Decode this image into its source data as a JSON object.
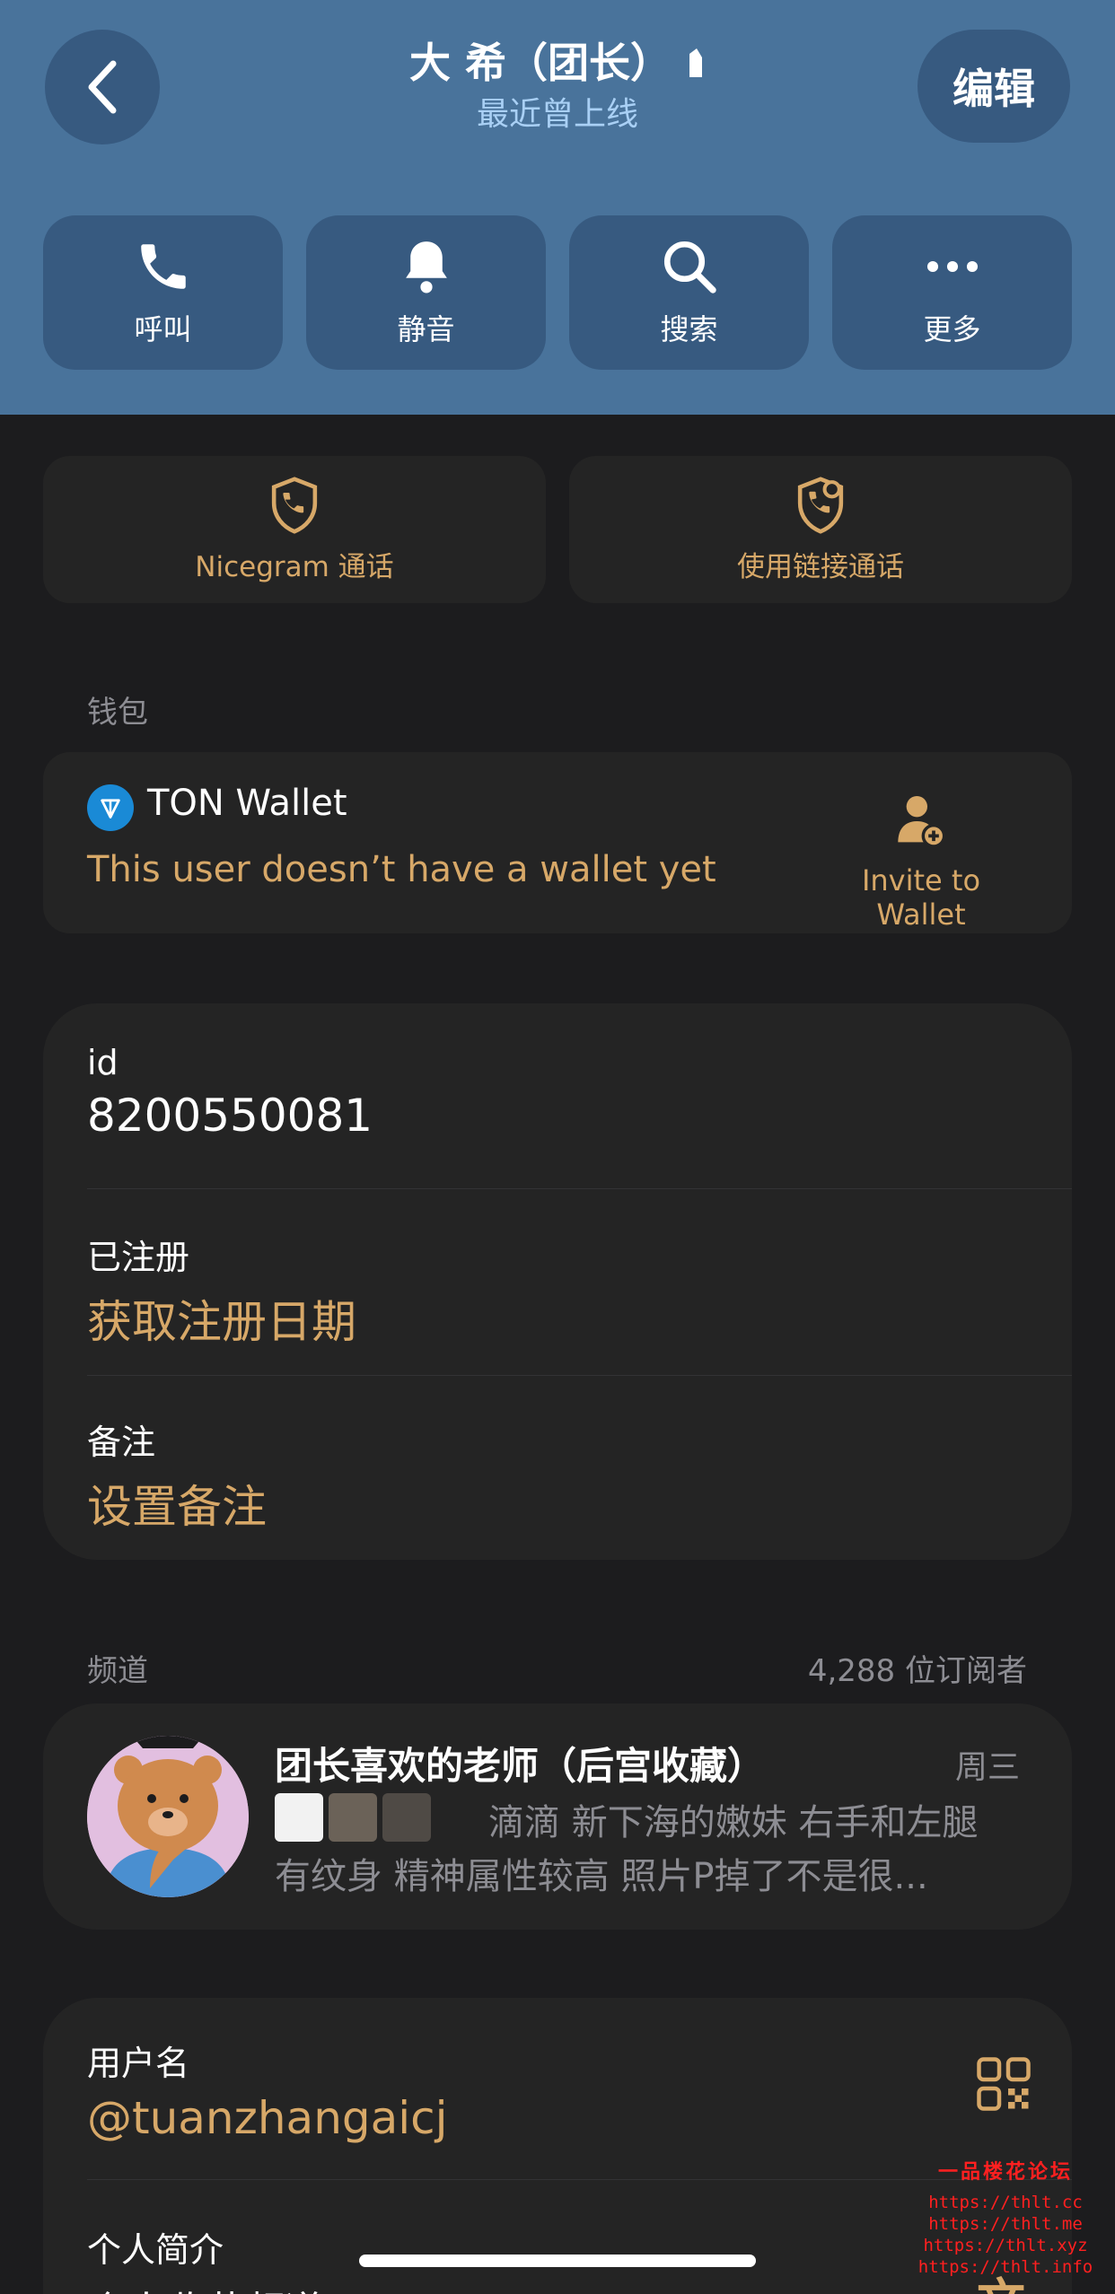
{
  "header": {
    "title": "大 希（团长）",
    "status": "最近曾上线",
    "edit_label": "编辑",
    "actions": [
      {
        "label": "呼叫",
        "icon": "phone-icon"
      },
      {
        "label": "静音",
        "icon": "bell-icon"
      },
      {
        "label": "搜索",
        "icon": "search-icon"
      },
      {
        "label": "更多",
        "icon": "more-icon"
      }
    ]
  },
  "calls": {
    "nicegram_label": "Nicegram 通话",
    "link_call_label": "使用链接通话"
  },
  "wallet": {
    "section_label": "钱包",
    "name": "TON Wallet",
    "message": "This user doesn’t have a wallet yet",
    "invite_label": "Invite to Wallet"
  },
  "info": {
    "id_label": "id",
    "id_value": "8200550081",
    "registered_label": "已注册",
    "registered_value": "获取注册日期",
    "note_label": "备注",
    "note_value": "设置备注"
  },
  "channel": {
    "section_label": "频道",
    "subscribers": "4,288 位订阅者",
    "title": "团长喜欢的老师（后宫收藏）",
    "day": "周三",
    "preview_line1": "滴滴 新下海的嫩妹 右手和左腿",
    "preview_line2": "有纹身 精神属性较高 照片P掉了不是很..."
  },
  "user": {
    "username_label": "用户名",
    "username_value": "@tuanzhangaicj",
    "bio_label": "个人简介",
    "bio_value": "个人收藏频道：https://t.me/"
  },
  "watermark": {
    "title": "一品楼花论坛",
    "urls": [
      "https://thlt.cc",
      "https://thlt.me",
      "https://thlt.xyz",
      "https://thlt.info"
    ]
  },
  "colors": {
    "header_bg": "#49739b",
    "header_button": "#375a80",
    "accent_gold": "#d7a868",
    "card_bg": "#242424",
    "page_bg": "#1c1c1e"
  }
}
